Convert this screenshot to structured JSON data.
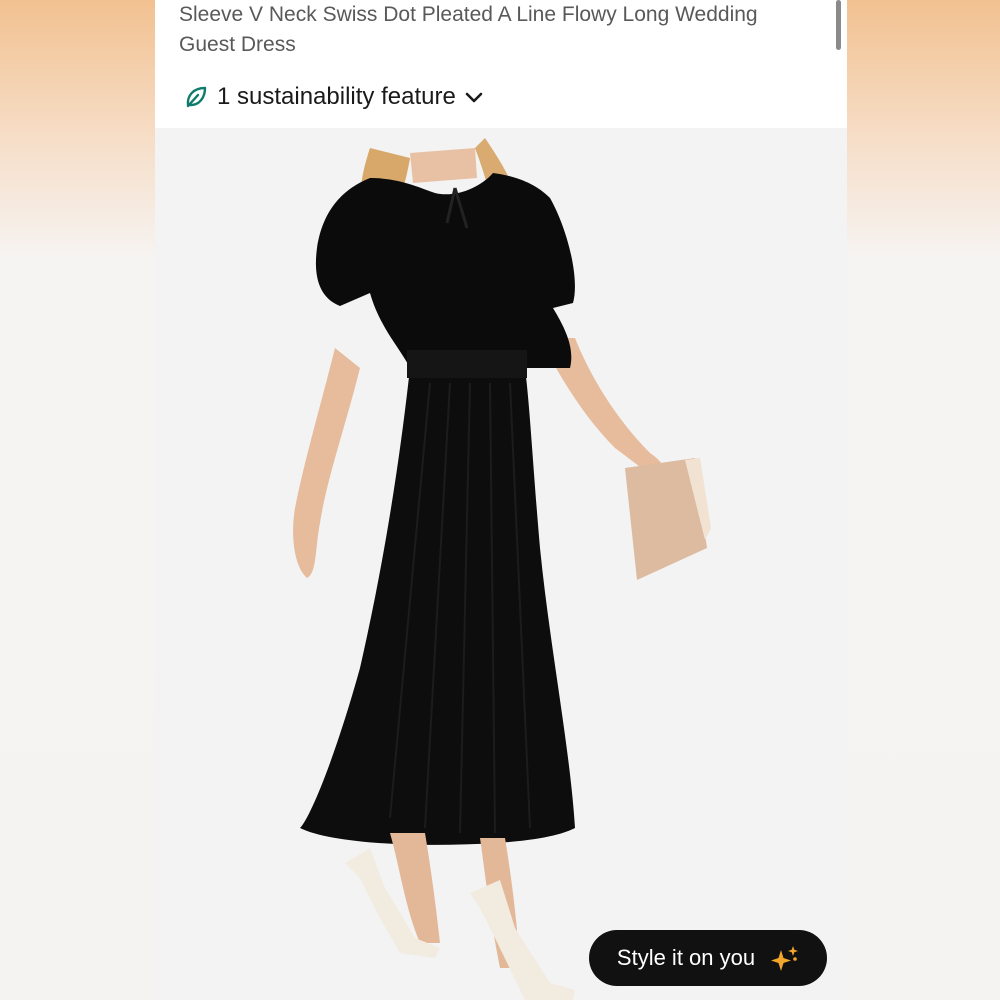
{
  "product": {
    "title_line1": "Sleeve V Neck Swiss Dot Pleated A Line Flowy Long Wedding",
    "title_line2": "Guest Dress"
  },
  "sustainability": {
    "label": "1 sustainability feature",
    "icon": "leaf-icon",
    "expand_icon": "chevron-down-icon"
  },
  "style_button": {
    "label": "Style it on you",
    "icon": "sparkle-icon"
  },
  "colors": {
    "leaf": "#0f7b6c",
    "button_bg": "#111111",
    "sparkle": "#f4a62a"
  }
}
